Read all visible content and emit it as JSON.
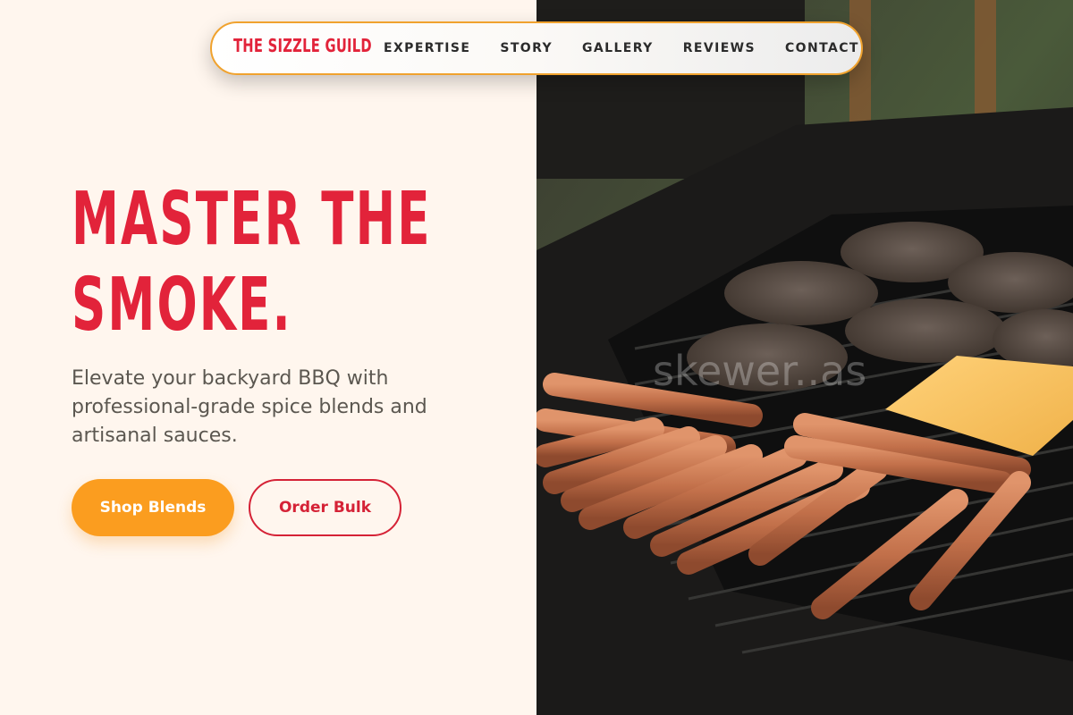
{
  "nav": {
    "brand": "THE SIZZLE GUILD",
    "links": [
      "EXPERTISE",
      "STORY",
      "GALLERY",
      "REVIEWS",
      "CONTACT"
    ]
  },
  "hero": {
    "title_line1": "MASTER THE",
    "title_line2": "SMOKE.",
    "subtitle": "Elevate your backyard BBQ with professional-grade spice blends and artisanal sauces.",
    "primary_button": "Shop Blends",
    "secondary_button": "Order Bulk"
  },
  "image": {
    "description_icon": "bbq-grill-photo",
    "watermark": "skewer..as"
  },
  "colors": {
    "accent_red": "#e2233a",
    "accent_orange": "#fb9d1f",
    "background": "#fff6ee"
  }
}
